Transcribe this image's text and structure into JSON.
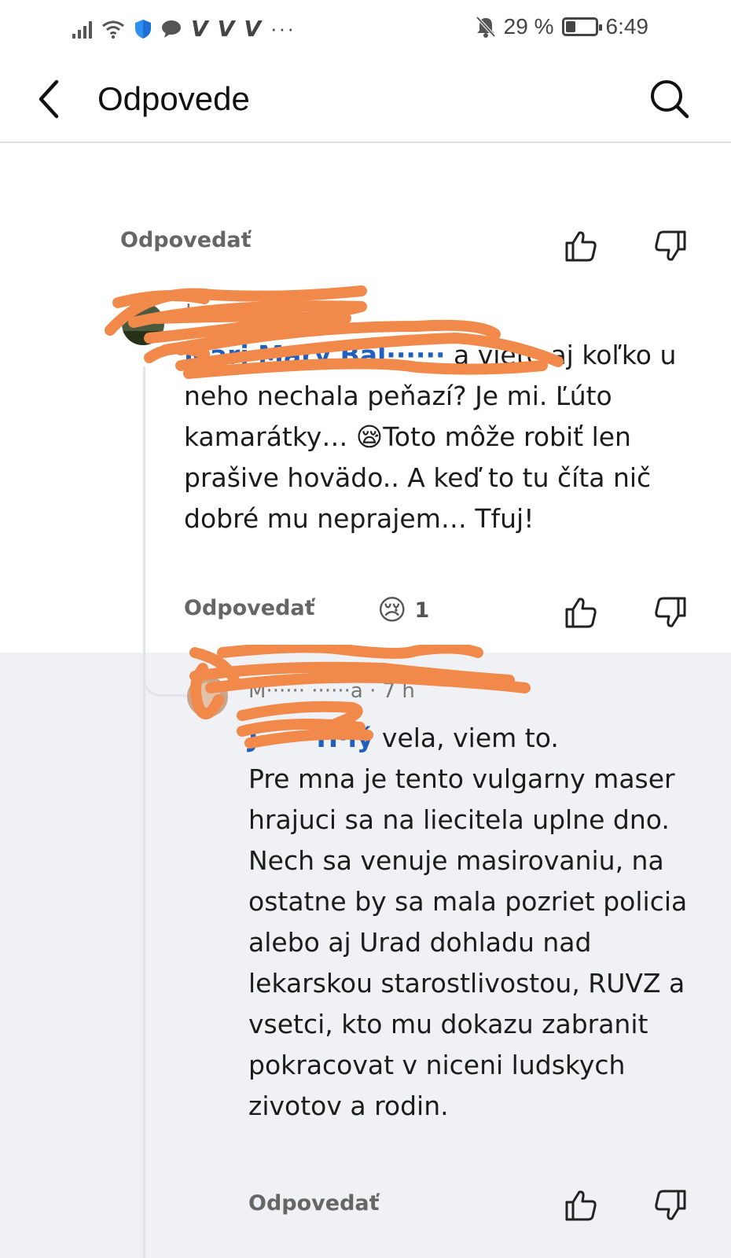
{
  "status_bar": {
    "carrier_marks": [
      "V",
      "V",
      "V"
    ],
    "more": "···",
    "battery": "29 %",
    "battery_level": 0.29,
    "time": "6:49"
  },
  "header": {
    "title": "Odpovede"
  },
  "top_actions": {
    "reply_label": "Odpovedať"
  },
  "comment1": {
    "author_redacted": "Jo··· M······ · ··h",
    "mention": "Mari Mary Bal······",
    "text": " a viete aj koľko u neho nechala peňazí? Je mi. Ľúto kamarátky… 😪Toto môže robiť len prašive hovädo.. A keď to tu číta nič dobré mu neprajem… Tfuj!",
    "reply_label": "Odpovedať",
    "reaction_emoji": "😢",
    "reaction_count": "1"
  },
  "comment2": {
    "author_redacted": "M······ ······a",
    "time": " · 7 h",
    "mention": "J····· H·lý",
    "text": " vela, viem to.\nPre mna je tento vulgarny maser hrajuci sa na liecitela uplne dno.\nNech sa venuje masirovaniu, na ostatne by sa mala pozriet policia alebo aj Urad dohladu nad lekarskou starostlivostou, RUVZ a vsetci, kto mu dokazu zabranit pokracovat v niceni ludskych zivotov a rodin.",
    "reply_label": "Odpovedať"
  },
  "colors": {
    "accent": "#1f5fbf",
    "redaction": "#f0894a",
    "reply_bg": "#f0f1f4"
  },
  "icons": [
    "back-arrow-icon",
    "search-icon",
    "thumbs-up-icon",
    "thumbs-down-icon",
    "wifi-icon",
    "shield-icon",
    "chat-icon",
    "mute-bell-icon",
    "battery-icon"
  ]
}
